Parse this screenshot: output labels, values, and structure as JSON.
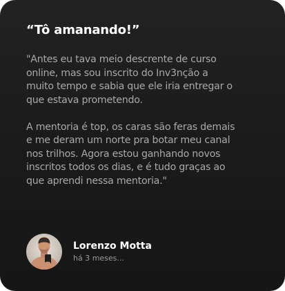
{
  "testimonial": {
    "title": "“Tô amanando!”",
    "paragraphs": [
      "\"Antes eu tava meio descrente de curso\nonline, mas sou inscrito do Inv3nção a\nmuito tempo e sabia que ele iria entregar o\nque estava prometendo.",
      "A mentoria é top, os caras são feras demais\ne me deram um norte pra botar meu canal\nnos trilhos. Agora estou ganhando novos\ninscritos todos os dias, e é tudo graças ao\nque aprendi nessa mentoria.\""
    ],
    "author": {
      "name": "Lorenzo Motta",
      "time": "há 3 meses..."
    }
  },
  "colors": {
    "card_background": "#1c1c1c",
    "title": "#ffffff",
    "body_text": "#a9a9a9",
    "author_name": "#ffffff",
    "author_time": "#9a9a9a"
  },
  "icons": {
    "avatar": "user-photo"
  }
}
